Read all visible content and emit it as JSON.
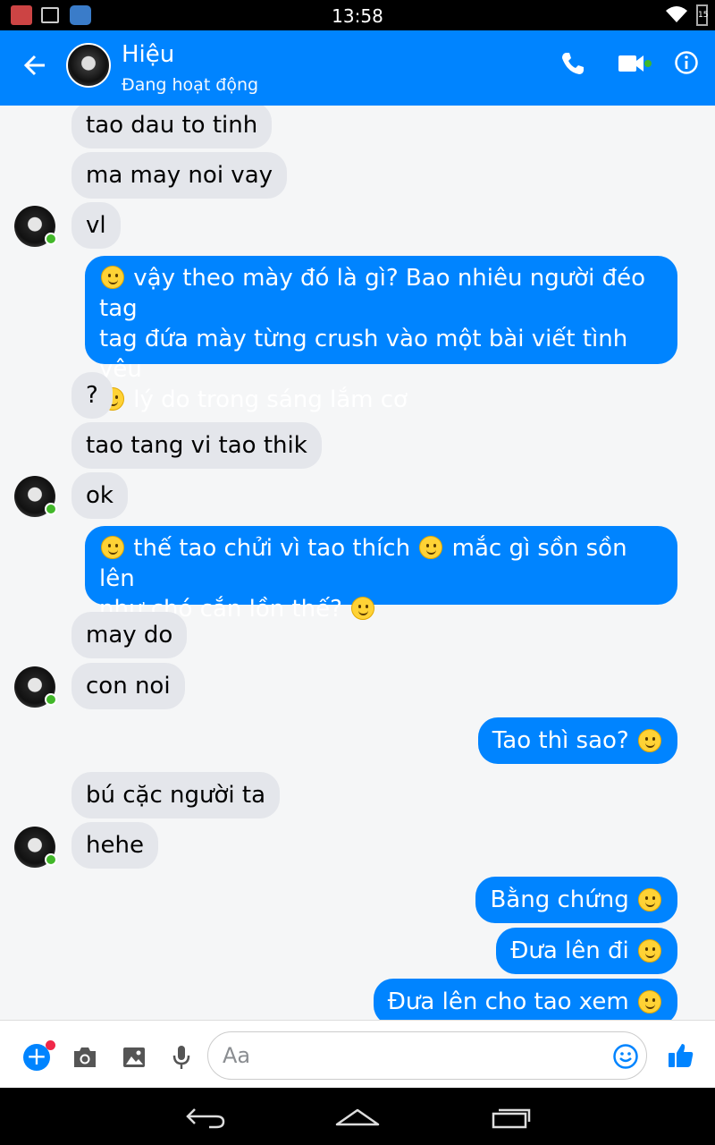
{
  "status_bar": {
    "time": "13:58",
    "battery": "15"
  },
  "header": {
    "name": "Hiệu",
    "status": "Đang hoạt động"
  },
  "messages": [
    {
      "dir": "in",
      "text": "tao dau to tinh"
    },
    {
      "dir": "in",
      "text": "ma may noi vay"
    },
    {
      "dir": "in",
      "text": "vl"
    },
    {
      "dir": "out",
      "lines": [
        {
          "emoji": true,
          "text": "vậy theo mày đó là gì? Bao nhiêu người đéo tag"
        },
        {
          "emoji": false,
          "text": "tag đứa mày từng crush vào một bài viết tình yêu"
        },
        {
          "emoji": true,
          "text": "lý do trong sáng lắm cơ"
        }
      ]
    },
    {
      "dir": "in",
      "text": "?"
    },
    {
      "dir": "in",
      "text": "tao tang vi tao thik"
    },
    {
      "dir": "in",
      "text": "ok"
    },
    {
      "dir": "out",
      "parts": [
        "thế tao chửi vì tao thích",
        "mắc gì sồn sồn lên",
        "như chó cắn lồn thế?"
      ]
    },
    {
      "dir": "in",
      "text": "may do"
    },
    {
      "dir": "in",
      "text": "con noi"
    },
    {
      "dir": "out",
      "text": "Tao thì sao?"
    },
    {
      "dir": "in",
      "text": "bú cặc người ta"
    },
    {
      "dir": "in",
      "text": "hehe"
    },
    {
      "dir": "out",
      "text": "Bằng chứng"
    },
    {
      "dir": "out",
      "text": "Đưa lên đi"
    },
    {
      "dir": "out",
      "text": "Đưa lên cho tao xem"
    }
  ],
  "composer": {
    "placeholder": "Aa"
  },
  "icons": {
    "accent": "#0084ff",
    "incoming_bubble": "#e4e6eb",
    "online_dot": "#42b72a"
  }
}
